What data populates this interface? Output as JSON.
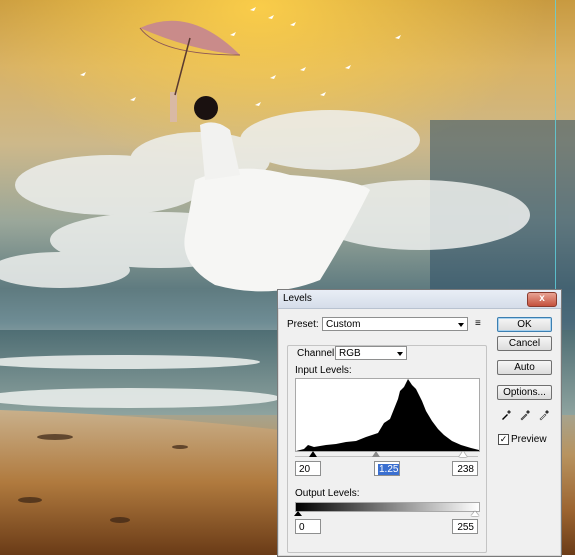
{
  "dialog": {
    "title": "Levels",
    "close_label": "x",
    "preset_label": "Preset:",
    "preset_value": "Custom",
    "preset_menu_glyph": "≡",
    "channel_label": "Channel:",
    "channel_value": "RGB",
    "input_levels_label": "Input Levels:",
    "input_black": "20",
    "input_gamma": "1.25",
    "input_white": "238",
    "output_levels_label": "Output Levels:",
    "output_black": "0",
    "output_white": "255",
    "buttons": {
      "ok": "OK",
      "cancel": "Cancel",
      "auto": "Auto",
      "options": "Options..."
    },
    "preview_label": "Preview",
    "preview_checked": "✓"
  },
  "colors": {
    "guide_line": "#5fd3e0",
    "selection": "#3a6fd0",
    "close_button": "#c4513d"
  }
}
